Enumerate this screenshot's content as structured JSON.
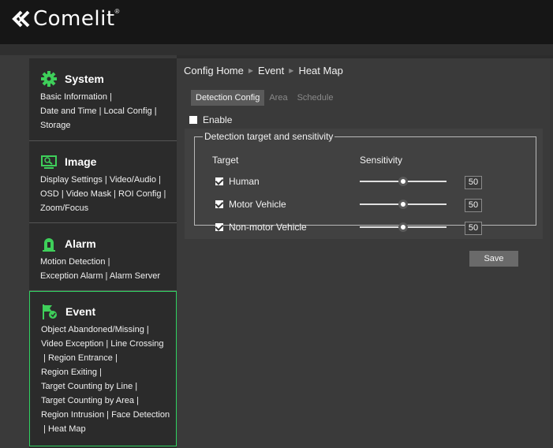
{
  "brand": {
    "name": "Comelit",
    "reg": "®"
  },
  "sidebar": {
    "groups": [
      {
        "title": "System",
        "icon": "gear-icon",
        "links": "Basic Information |\nDate and Time | Local Config |\nStorage"
      },
      {
        "title": "Image",
        "icon": "image-icon",
        "links": "Display Settings | Video/Audio |\nOSD | Video Mask | ROI Config |\nZoom/Focus"
      },
      {
        "title": "Alarm",
        "icon": "alarm-icon",
        "links": "Motion Detection |\nException Alarm | Alarm Server"
      },
      {
        "title": "Event",
        "icon": "event-flag-icon",
        "links": "Object Abandoned/Missing |\nVideo Exception | Line Crossing\n | Region Entrance |\nRegion Exiting |\nTarget Counting by Line |\nTarget Counting by Area |\nRegion Intrusion | Face Detection\n | Heat Map"
      }
    ]
  },
  "breadcrumb": [
    "Config Home",
    "Event",
    "Heat Map"
  ],
  "tabs": [
    "Detection Config",
    "Area",
    "Schedule"
  ],
  "active_tab": "Detection Config",
  "enable": {
    "label": "Enable",
    "checked": false
  },
  "detection": {
    "legend": "Detection target and sensitivity",
    "target_header": "Target",
    "sensitivity_header": "Sensitivity",
    "rows": [
      {
        "label": "Human",
        "checked": true,
        "sensitivity": "50",
        "level": 0.5
      },
      {
        "label": "Motor Vehicle",
        "checked": true,
        "sensitivity": "50",
        "level": 0.5
      },
      {
        "label": "Non-motor Vehicle",
        "checked": true,
        "sensitivity": "50",
        "level": 0.5
      }
    ]
  },
  "save_label": "Save",
  "colors": {
    "accent": "#2fd060",
    "topbar": "#161616",
    "panel": "#414141"
  }
}
